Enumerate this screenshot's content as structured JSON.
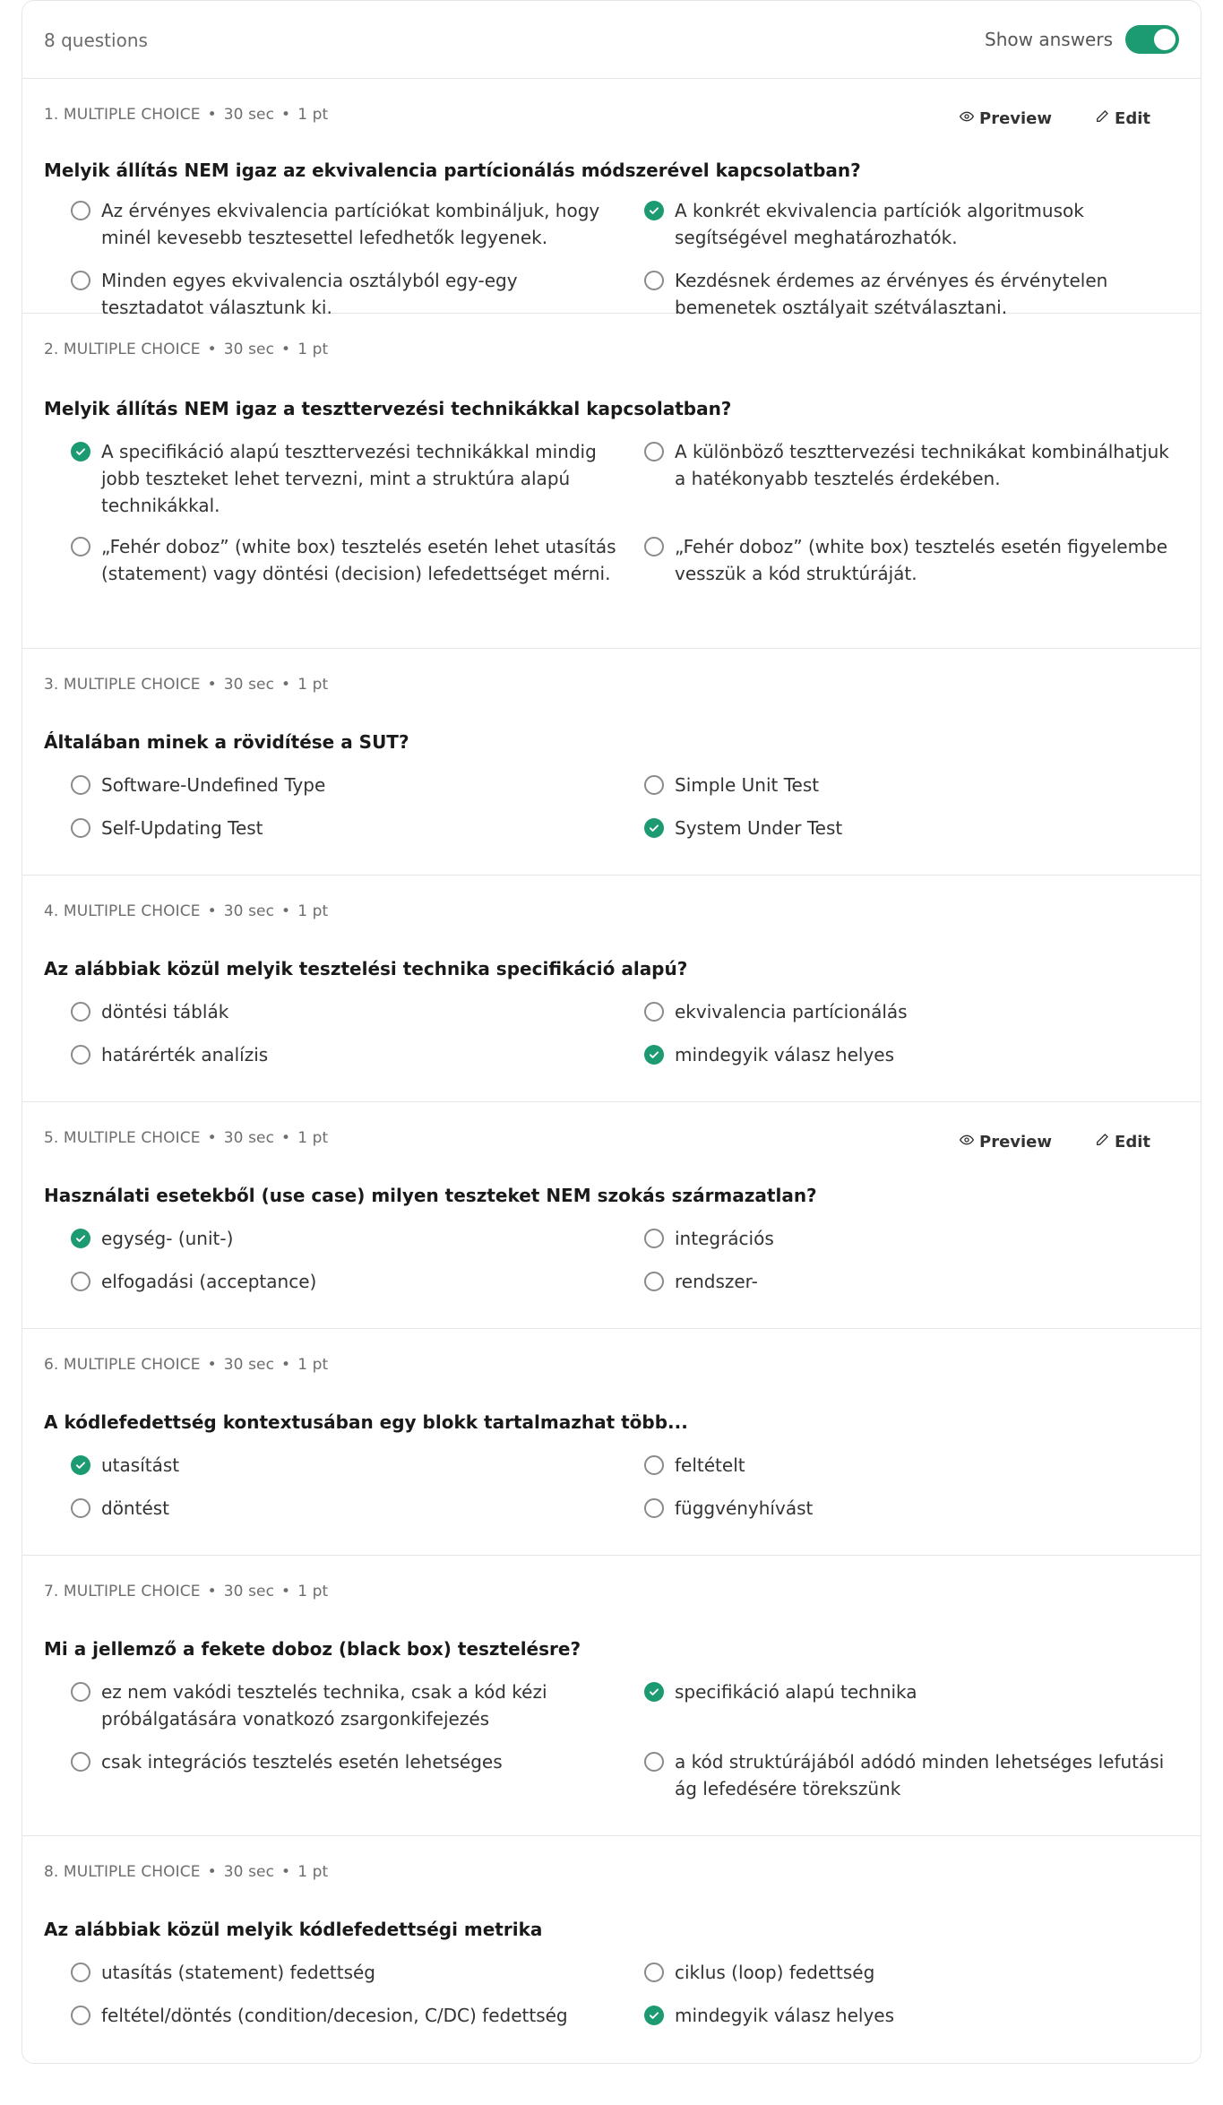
{
  "header": {
    "question_count": "8 questions",
    "show_answers_label": "Show answers"
  },
  "actions": {
    "preview_label": "Preview",
    "edit_label": "Edit"
  },
  "questions": [
    {
      "meta_type": "1. MULTIPLE CHOICE",
      "meta_time": "30 sec",
      "meta_points": "1 pt",
      "text": "Melyik állítás NEM igaz az ekvivalencia partícionálás módszerével kapcsolatban?",
      "options": [
        {
          "text": "Az érvényes ekvivalencia partíciókat kombináljuk, hogy minél kevesebb tesztesettel lefedhetők legyenek.",
          "correct": false
        },
        {
          "text": "A konkrét ekvivalencia partíciók algoritmusok segítségével meghatározhatók.",
          "correct": true
        },
        {
          "text": "Minden egyes ekvivalencia osztályból egy-egy tesztadatot választunk ki.",
          "correct": false
        },
        {
          "text": "Kezdésnek érdemes az érvényes és érvénytelen bemenetek osztályait szétválasztani.",
          "correct": false
        }
      ]
    },
    {
      "meta_type": "2. MULTIPLE CHOICE",
      "meta_time": "30 sec",
      "meta_points": "1 pt",
      "text": "Melyik állítás NEM igaz a teszttervezési technikákkal kapcsolatban?",
      "options": [
        {
          "text": "A specifikáció alapú teszttervezési technikákkal mindig jobb teszteket lehet tervezni, mint a struktúra alapú technikákkal.",
          "correct": true
        },
        {
          "text": "A különböző teszttervezési technikákat kombinálhatjuk a hatékonyabb tesztelés érdekében.",
          "correct": false
        },
        {
          "text": "„Fehér doboz” (white box) tesztelés esetén lehet utasítás (statement) vagy döntési (decision) lefedettséget mérni.",
          "correct": false
        },
        {
          "text": "„Fehér doboz” (white box) tesztelés esetén figyelembe vesszük a kód struktúráját.",
          "correct": false
        }
      ]
    },
    {
      "meta_type": "3. MULTIPLE CHOICE",
      "meta_time": "30 sec",
      "meta_points": "1 pt",
      "text": "Általában minek a rövidítése a SUT?",
      "options": [
        {
          "text": "Software-Undefined Type",
          "correct": false
        },
        {
          "text": "Simple Unit Test",
          "correct": false
        },
        {
          "text": "Self-Updating Test",
          "correct": false
        },
        {
          "text": "System Under Test",
          "correct": true
        }
      ]
    },
    {
      "meta_type": "4. MULTIPLE CHOICE",
      "meta_time": "30 sec",
      "meta_points": "1 pt",
      "text": "Az alábbiak közül melyik tesztelési technika specifikáció alapú?",
      "options": [
        {
          "text": "döntési táblák",
          "correct": false
        },
        {
          "text": "ekvivalencia partícionálás",
          "correct": false
        },
        {
          "text": "határérték analízis",
          "correct": false
        },
        {
          "text": "mindegyik válasz helyes",
          "correct": true
        }
      ]
    },
    {
      "meta_type": "5. MULTIPLE CHOICE",
      "meta_time": "30 sec",
      "meta_points": "1 pt",
      "text": "Használati esetekből (use case) milyen teszteket NEM szokás származatlan?",
      "options": [
        {
          "text": "egység- (unit-)",
          "correct": true
        },
        {
          "text": "integrációs",
          "correct": false
        },
        {
          "text": "elfogadási (acceptance)",
          "correct": false
        },
        {
          "text": "rendszer-",
          "correct": false
        }
      ]
    },
    {
      "meta_type": "6. MULTIPLE CHOICE",
      "meta_time": "30 sec",
      "meta_points": "1 pt",
      "text": "A kódlefedettség kontextusában egy blokk tartalmazhat több...",
      "options": [
        {
          "text": "utasítást",
          "correct": true
        },
        {
          "text": "feltételt",
          "correct": false
        },
        {
          "text": "döntést",
          "correct": false
        },
        {
          "text": "függvényhívást",
          "correct": false
        }
      ]
    },
    {
      "meta_type": "7. MULTIPLE CHOICE",
      "meta_time": "30 sec",
      "meta_points": "1 pt",
      "text": "Mi a jellemző a fekete doboz (black box) tesztelésre?",
      "options": [
        {
          "text": "ez nem vakódi tesztelés technika, csak a kód kézi próbálgatására vonatkozó zsargonkifejezés",
          "correct": false
        },
        {
          "text": "specifikáció alapú technika",
          "correct": true
        },
        {
          "text": "csak integrációs tesztelés esetén lehetséges",
          "correct": false
        },
        {
          "text": "a kód struktúrájából adódó minden lehetséges lefutási ág lefedésére törekszünk",
          "correct": false
        }
      ]
    },
    {
      "meta_type": "8. MULTIPLE CHOICE",
      "meta_time": "30 sec",
      "meta_points": "1 pt",
      "text": "Az alábbiak közül melyik kódlefedettségi metrika",
      "options": [
        {
          "text": "utasítás (statement) fedettség",
          "correct": false
        },
        {
          "text": "ciklus (loop) fedettség",
          "correct": false
        },
        {
          "text": "feltétel/döntés (condition/decesion, C/DC) fedettség",
          "correct": false
        },
        {
          "text": "mindegyik válasz helyes",
          "correct": true
        }
      ]
    }
  ],
  "colors": {
    "accent": "#1c9a71",
    "border": "#e6e6e6",
    "muted_text": "#6e6e6e"
  }
}
